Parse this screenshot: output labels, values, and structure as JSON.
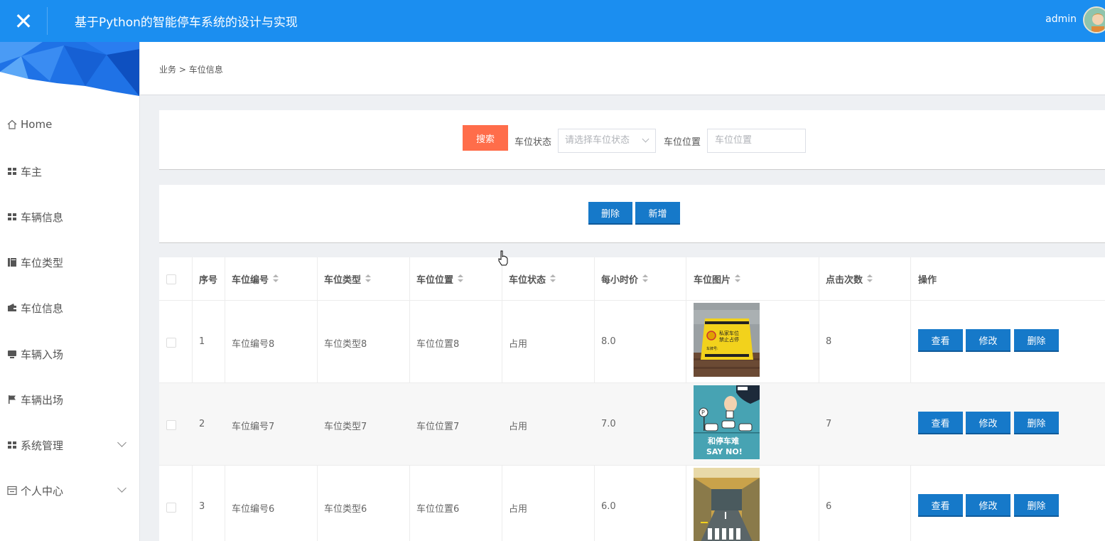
{
  "header": {
    "close_icon": "close-icon",
    "title": "基于Python的智能停车系统的设计与实现",
    "user": "admin",
    "bg_color": "#1b8ef0"
  },
  "sidebar": {
    "items": [
      {
        "label": "Home",
        "icon": "home-icon"
      },
      {
        "label": "车主",
        "icon": "grid-icon"
      },
      {
        "label": "车辆信息",
        "icon": "grid-icon"
      },
      {
        "label": "车位类型",
        "icon": "book-icon"
      },
      {
        "label": "车位信息",
        "icon": "wallet-icon"
      },
      {
        "label": "车辆入场",
        "icon": "monitor-icon"
      },
      {
        "label": "车辆出场",
        "icon": "flag-icon"
      },
      {
        "label": "系统管理",
        "icon": "grid-icon",
        "expandable": true
      },
      {
        "label": "个人中心",
        "icon": "profile-icon",
        "expandable": true
      }
    ]
  },
  "breadcrumb": {
    "parent": "业务",
    "separator": ">",
    "current": "车位信息"
  },
  "search": {
    "button": "搜索",
    "status_label": "车位状态",
    "status_placeholder": "请选择车位状态",
    "location_label": "车位位置",
    "location_placeholder": "车位位置",
    "button_color": "#ff6d4a"
  },
  "actions": {
    "delete": "删除",
    "add": "新增",
    "button_color": "#1679c9"
  },
  "table": {
    "headers": [
      "序号",
      "车位编号",
      "车位类型",
      "车位位置",
      "车位状态",
      "每小时价",
      "车位图片",
      "点击次数",
      "操作"
    ],
    "rows": [
      {
        "index": "1",
        "code": "车位编号8",
        "type": "车位类型8",
        "location": "车位位置8",
        "status": "占用",
        "price": "8.0",
        "clicks": "8"
      },
      {
        "index": "2",
        "code": "车位编号7",
        "type": "车位类型7",
        "location": "车位位置7",
        "status": "占用",
        "price": "7.0",
        "clicks": "7"
      },
      {
        "index": "3",
        "code": "车位编号6",
        "type": "车位类型6",
        "location": "车位位置6",
        "status": "占用",
        "price": "6.0",
        "clicks": "6"
      }
    ],
    "row_actions": {
      "view": "查看",
      "edit": "修改",
      "delete": "删除"
    },
    "thumb1": {
      "line1": "私家车位",
      "line2": "禁止占停",
      "tag": "车牌号:"
    },
    "thumb2": {
      "line1": "和停车难",
      "line2": "SAY NO!"
    }
  }
}
